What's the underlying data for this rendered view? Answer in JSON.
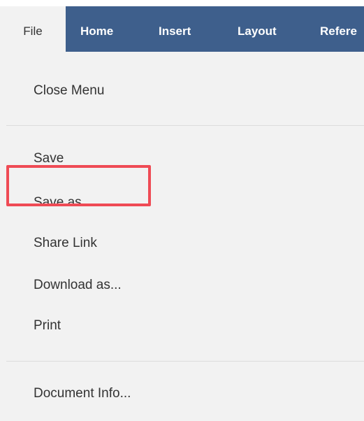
{
  "tabs": [
    {
      "label": "File",
      "active": true
    },
    {
      "label": "Home",
      "active": false
    },
    {
      "label": "Insert",
      "active": false
    },
    {
      "label": "Layout",
      "active": false
    },
    {
      "label": "Refere",
      "active": false
    }
  ],
  "file_menu": {
    "close_menu": "Close Menu",
    "save": "Save",
    "save_as": "Save as...",
    "share_link": "Share Link",
    "download_as": "Download as...",
    "print": "Print",
    "document_info": "Document Info..."
  },
  "colors": {
    "tabbar_background": "#3e5f8c",
    "menu_background": "#f2f2f2",
    "highlight_border": "#ef4b55"
  }
}
